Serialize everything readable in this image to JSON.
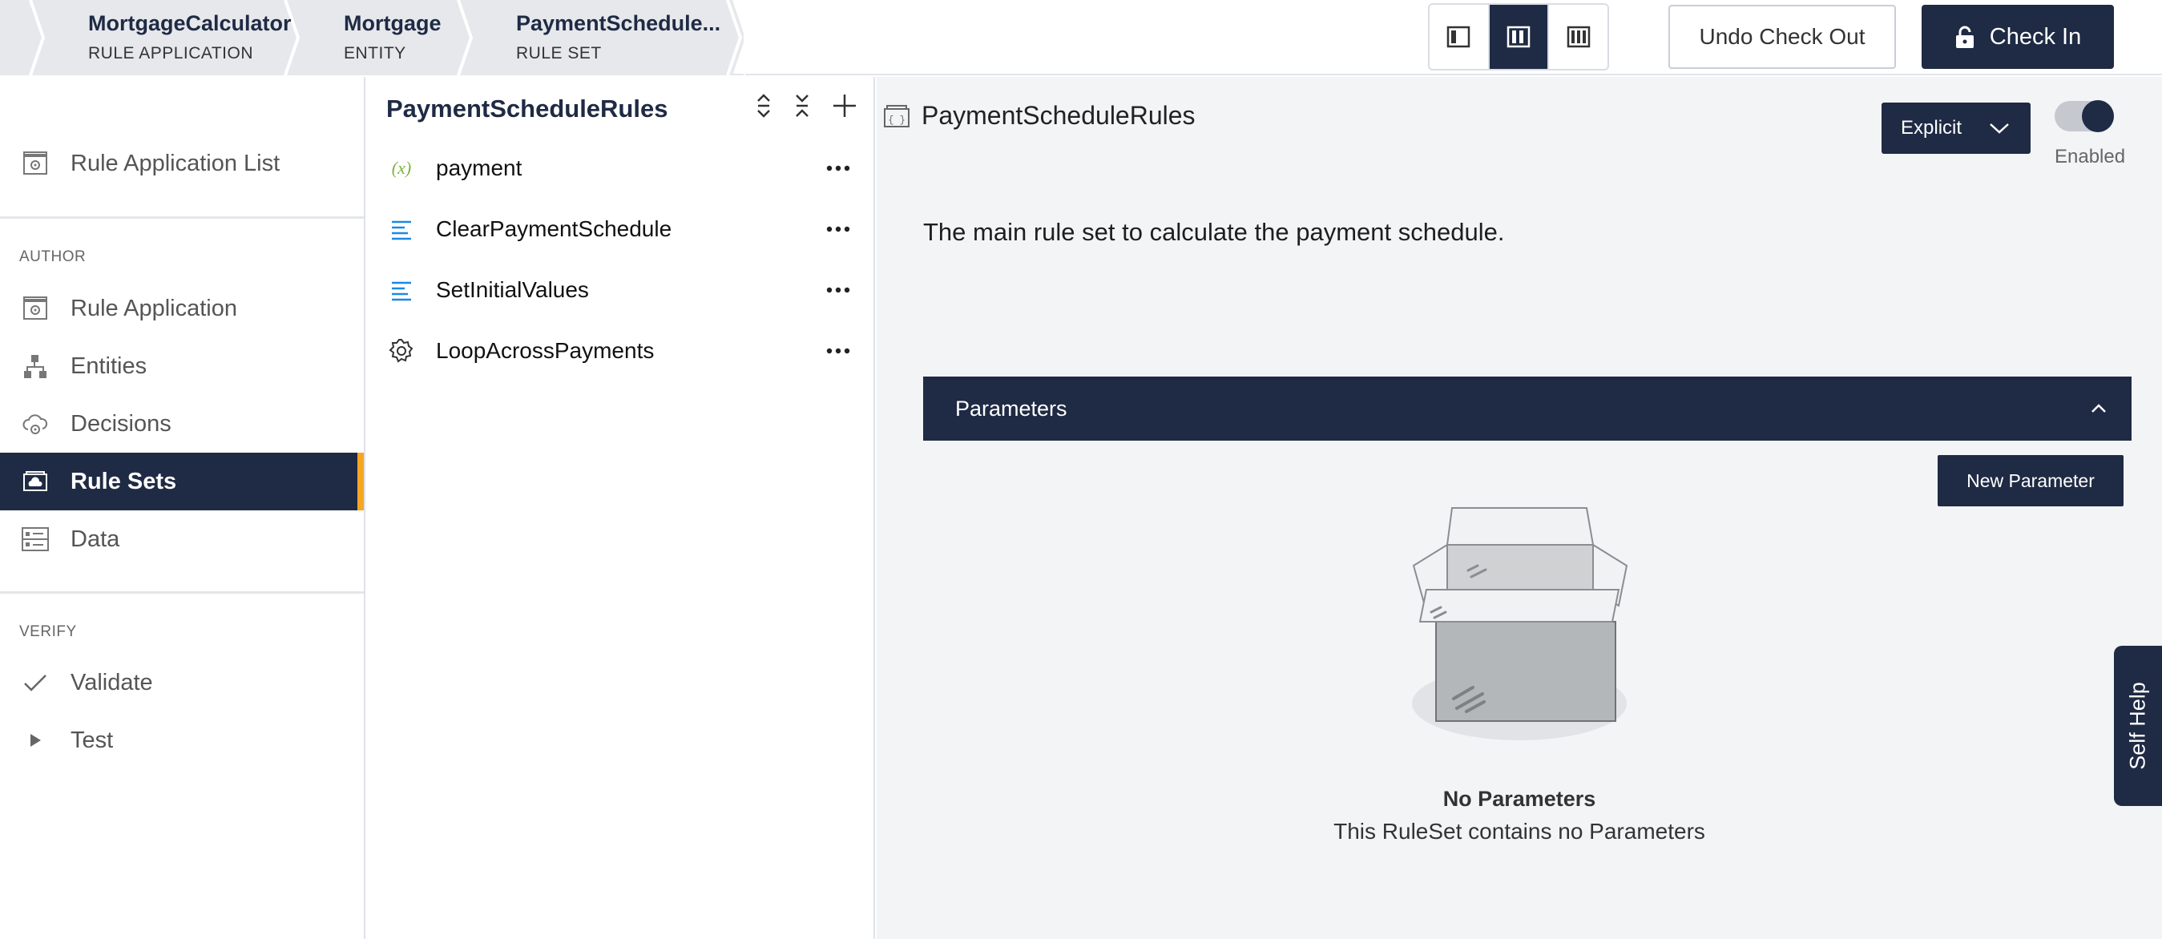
{
  "breadcrumbs": [
    {
      "title": "MortgageCalculator",
      "subtitle": "RULE APPLICATION"
    },
    {
      "title": "Mortgage",
      "subtitle": "ENTITY"
    },
    {
      "title": "PaymentSchedule...",
      "subtitle": "RULE SET"
    }
  ],
  "view_toggle": {
    "active_index": 1
  },
  "header": {
    "undo_label": "Undo Check Out",
    "checkin_label": "Check In"
  },
  "leftnav": {
    "top_item": {
      "label": "Rule Application List",
      "icon": "app-list-icon"
    },
    "author_section": "AUTHOR",
    "author_items": [
      {
        "label": "Rule Application",
        "icon": "gear-doc-icon"
      },
      {
        "label": "Entities",
        "icon": "hierarchy-icon"
      },
      {
        "label": "Decisions",
        "icon": "cloud-gear-icon"
      },
      {
        "label": "Rule Sets",
        "icon": "ruleset-icon"
      },
      {
        "label": "Data",
        "icon": "data-icon"
      }
    ],
    "verify_section": "VERIFY",
    "verify_items": [
      {
        "label": "Validate",
        "icon": "checkmark-icon"
      },
      {
        "label": "Test",
        "icon": "play-icon"
      }
    ],
    "active": "Rule Sets"
  },
  "tree": {
    "title": "PaymentScheduleRules",
    "items": [
      {
        "label": "payment",
        "icon": "variable-icon"
      },
      {
        "label": "ClearPaymentSchedule",
        "icon": "lines-icon"
      },
      {
        "label": "SetInitialValues",
        "icon": "lines-icon"
      },
      {
        "label": "LoopAcrossPayments",
        "icon": "gear-icon"
      }
    ]
  },
  "main": {
    "title": "PaymentScheduleRules",
    "mode": "Explicit",
    "enabled_label": "Enabled",
    "enabled": true,
    "description": "The main rule set to calculate the payment schedule.",
    "panel_title": "Parameters",
    "new_param_label": "New Parameter",
    "empty_title": "No Parameters",
    "empty_sub": "This RuleSet contains no Parameters"
  },
  "self_help": "Self Help",
  "colors": {
    "navy": "#1f2a44",
    "accent": "#f5a623",
    "panel_bg": "#f3f4f6"
  }
}
